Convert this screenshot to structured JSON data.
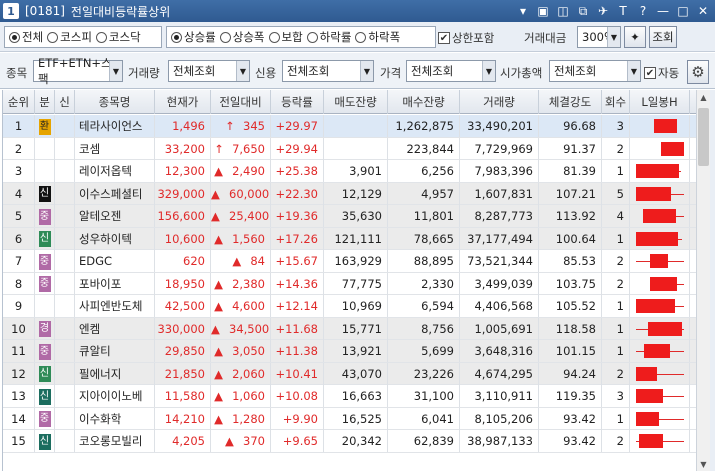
{
  "window": {
    "num": "1",
    "code": "[0181]",
    "title": "전일대비등락률상위"
  },
  "filters": {
    "market": [
      "전체",
      "코스피",
      "코스닥"
    ],
    "sort": [
      "상승률",
      "상승폭",
      "보합",
      "하락률",
      "하락폭"
    ],
    "limit_label": "상한포함",
    "trade_amount_label": "거래대금",
    "trade_amount_value": "300억",
    "query_button": "조회",
    "item_label": "종목",
    "item_value": "ETF+ETN+스팩",
    "volume_label": "거래량",
    "volume_value": "전체조회",
    "credit_label": "신용",
    "credit_value": "전체조회",
    "price_label": "가격",
    "price_value": "전체조회",
    "mcap_label": "시가총액",
    "mcap_value": "전체조회",
    "auto_label": "자동"
  },
  "colors": {
    "up": "#e02a2a",
    "candle": "#ee1c1c"
  },
  "columns": [
    "순위",
    "분",
    "신",
    "종목명",
    "현재가",
    "전일대비",
    "등락률",
    "매도잔량",
    "매수잔량",
    "거래량",
    "체결강도",
    "회수",
    "L일봉H"
  ],
  "rows": [
    {
      "rank": "1",
      "tag": "환",
      "tagColor": "#e6a400",
      "name": "테라사이언스",
      "price": "1,496",
      "sign": "↑",
      "diff": "345",
      "rate": "+29.97",
      "ask": "",
      "bid": "1,262,875",
      "vol": "33,490,201",
      "str": "96.68",
      "cnt": "3",
      "candle": [
        0.38,
        0.82,
        0.38,
        0.82
      ],
      "selected": true
    },
    {
      "rank": "2",
      "tag": "",
      "tagColor": "",
      "name": "코셈",
      "price": "33,200",
      "sign": "↑",
      "diff": "7,650",
      "rate": "+29.94",
      "ask": "",
      "bid": "223,844",
      "vol": "7,729,969",
      "str": "91.37",
      "cnt": "2",
      "candle": [
        0.52,
        0.96,
        0.52,
        0.96
      ]
    },
    {
      "rank": "3",
      "tag": "",
      "tagColor": "",
      "name": "레이저옵텍",
      "price": "12,300",
      "sign": "▲",
      "diff": "2,490",
      "rate": "+25.38",
      "ask": "3,901",
      "bid": "6,256",
      "vol": "7,983,396",
      "str": "81.39",
      "cnt": "1",
      "candle": [
        0.04,
        0.9,
        0.04,
        0.86
      ]
    },
    {
      "rank": "4",
      "tag": "신",
      "tagColor": "#111111",
      "name": "이수스페셜티",
      "price": "329,000",
      "sign": "▲",
      "diff": "60,000",
      "rate": "+22.30",
      "ask": "12,129",
      "bid": "4,957",
      "vol": "1,607,831",
      "str": "107.21",
      "cnt": "5",
      "candle": [
        0.04,
        0.96,
        0.04,
        0.72
      ]
    },
    {
      "rank": "5",
      "tag": "중",
      "tagColor": "#b06aa6",
      "name": "알테오젠",
      "price": "156,600",
      "sign": "▲",
      "diff": "25,400",
      "rate": "+19.36",
      "ask": "35,630",
      "bid": "11,801",
      "vol": "8,287,773",
      "str": "113.92",
      "cnt": "4",
      "candle": [
        0.18,
        0.96,
        0.18,
        0.8
      ]
    },
    {
      "rank": "6",
      "tag": "신",
      "tagColor": "#2e8b57",
      "name": "성우하이텍",
      "price": "10,600",
      "sign": "▲",
      "diff": "1,560",
      "rate": "+17.26",
      "ask": "121,111",
      "bid": "78,665",
      "vol": "37,177,494",
      "str": "100.64",
      "cnt": "1",
      "candle": [
        0.04,
        0.92,
        0.04,
        0.84
      ]
    },
    {
      "rank": "7",
      "tag": "중",
      "tagColor": "#b06aa6",
      "name": "EDGC",
      "price": "620",
      "sign": "▲",
      "diff": "84",
      "rate": "+15.67",
      "ask": "163,929",
      "bid": "88,895",
      "vol": "73,521,344",
      "str": "85.53",
      "cnt": "2",
      "candle": [
        0.04,
        0.96,
        0.3,
        0.66
      ]
    },
    {
      "rank": "8",
      "tag": "중",
      "tagColor": "#b06aa6",
      "name": "포바이포",
      "price": "18,950",
      "sign": "▲",
      "diff": "2,380",
      "rate": "+14.36",
      "ask": "77,775",
      "bid": "2,330",
      "vol": "3,499,039",
      "str": "103.75",
      "cnt": "2",
      "candle": [
        0.3,
        0.96,
        0.3,
        0.82
      ]
    },
    {
      "rank": "9",
      "tag": "",
      "tagColor": "",
      "name": "사피엔반도체",
      "price": "42,500",
      "sign": "▲",
      "diff": "4,600",
      "rate": "+12.14",
      "ask": "10,969",
      "bid": "6,594",
      "vol": "4,406,568",
      "str": "105.52",
      "cnt": "1",
      "candle": [
        0.04,
        0.96,
        0.04,
        0.78
      ]
    },
    {
      "rank": "10",
      "tag": "경",
      "tagColor": "#b06aa6",
      "name": "엔켐",
      "price": "330,000",
      "sign": "▲",
      "diff": "34,500",
      "rate": "+11.68",
      "ask": "15,771",
      "bid": "8,756",
      "vol": "1,005,691",
      "str": "118.58",
      "cnt": "1",
      "candle": [
        0.04,
        0.96,
        0.26,
        0.92
      ]
    },
    {
      "rank": "11",
      "tag": "중",
      "tagColor": "#b06aa6",
      "name": "큐알티",
      "price": "29,850",
      "sign": "▲",
      "diff": "3,050",
      "rate": "+11.38",
      "ask": "13,921",
      "bid": "5,699",
      "vol": "3,648,316",
      "str": "101.15",
      "cnt": "1",
      "candle": [
        0.04,
        0.96,
        0.2,
        0.7
      ]
    },
    {
      "rank": "12",
      "tag": "신",
      "tagColor": "#2e8b57",
      "name": "필에너지",
      "price": "21,850",
      "sign": "▲",
      "diff": "2,060",
      "rate": "+10.41",
      "ask": "43,070",
      "bid": "23,226",
      "vol": "4,674,295",
      "str": "94.24",
      "cnt": "2",
      "candle": [
        0.04,
        0.96,
        0.04,
        0.44
      ]
    },
    {
      "rank": "13",
      "tag": "신",
      "tagColor": "#1b6d5f",
      "name": "지아이이노베",
      "price": "11,580",
      "sign": "▲",
      "diff": "1,060",
      "rate": "+10.08",
      "ask": "16,663",
      "bid": "31,100",
      "vol": "3,110,911",
      "str": "119.35",
      "cnt": "3",
      "candle": [
        0.04,
        0.96,
        0.04,
        0.56
      ]
    },
    {
      "rank": "14",
      "tag": "중",
      "tagColor": "#b06aa6",
      "name": "이수화학",
      "price": "14,210",
      "sign": "▲",
      "diff": "1,280",
      "rate": "+9.90",
      "ask": "16,525",
      "bid": "6,041",
      "vol": "8,105,206",
      "str": "93.42",
      "cnt": "1",
      "candle": [
        0.04,
        0.96,
        0.04,
        0.48
      ]
    },
    {
      "rank": "15",
      "tag": "신",
      "tagColor": "#1b6d5f",
      "name": "코오롱모빌리",
      "price": "4,205",
      "sign": "▲",
      "diff": "370",
      "rate": "+9.65",
      "ask": "20,342",
      "bid": "62,839",
      "vol": "38,987,133",
      "str": "93.42",
      "cnt": "2",
      "candle": [
        0.04,
        0.96,
        0.1,
        0.56
      ]
    }
  ]
}
